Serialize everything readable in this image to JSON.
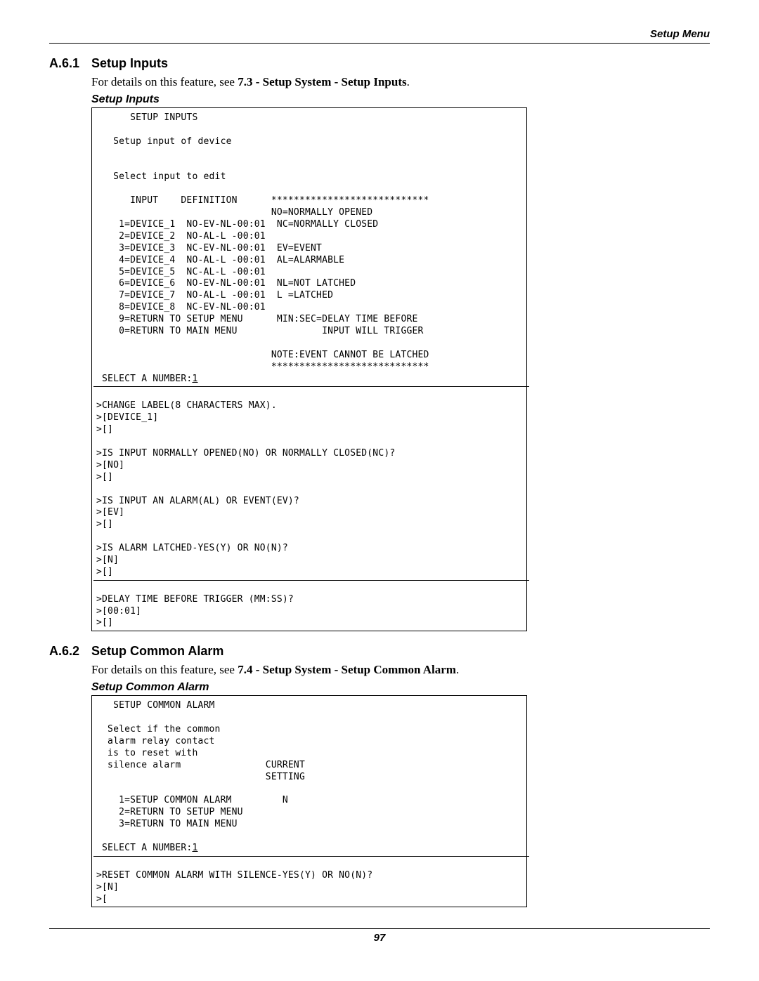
{
  "header": {
    "right": "Setup Menu"
  },
  "section1": {
    "num": "A.6.1",
    "title": "Setup Inputs",
    "intro_pre": "For details on this feature, see ",
    "intro_bold": "7.3 - Setup System - Setup Inputs",
    "intro_post": ".",
    "box_title": "Setup Inputs"
  },
  "terminal1": {
    "l01": "      SETUP INPUTS",
    "l02": "",
    "l03": "   Setup input of device",
    "l04": "",
    "l05": "",
    "l06": "   Select input to edit",
    "l07": "",
    "l08": "      INPUT    DEFINITION      ****************************",
    "l09": "                               NO=NORMALLY OPENED",
    "l10": "    1=DEVICE_1  NO-EV-NL-00:01  NC=NORMALLY CLOSED",
    "l11": "    2=DEVICE_2  NO-AL-L -00:01",
    "l12": "    3=DEVICE_3  NC-EV-NL-00:01  EV=EVENT",
    "l13": "    4=DEVICE_4  NO-AL-L -00:01  AL=ALARMABLE",
    "l14": "    5=DEVICE_5  NC-AL-L -00:01",
    "l15": "    6=DEVICE_6  NO-EV-NL-00:01  NL=NOT LATCHED",
    "l16": "    7=DEVICE_7  NO-AL-L -00:01  L =LATCHED",
    "l17": "    8=DEVICE_8  NC-EV-NL-00:01",
    "l18": "    9=RETURN TO SETUP MENU      MIN:SEC=DELAY TIME BEFORE",
    "l19": "    0=RETURN TO MAIN MENU               INPUT WILL TRIGGER",
    "l20": "",
    "l21": "                               NOTE:EVENT CANNOT BE LATCHED",
    "l22": "                               ****************************",
    "l23a": " SELECT A NUMBER:",
    "l23b": "1",
    "l24": "",
    "l25": ">CHANGE LABEL(8 CHARACTERS MAX).",
    "l26": ">[DEVICE_1]",
    "l27": ">[]",
    "l28": "",
    "l29": ">IS INPUT NORMALLY OPENED(NO) OR NORMALLY CLOSED(NC)?",
    "l30": ">[NO]",
    "l31": ">[]",
    "l32": "",
    "l33": ">IS INPUT AN ALARM(AL) OR EVENT(EV)?",
    "l34": ">[EV]",
    "l35": ">[]",
    "l36": "",
    "l37": ">IS ALARM LATCHED-YES(Y) OR NO(N)?",
    "l38": ">[N]",
    "l39": ">[]",
    "l40": "",
    "l41": ">DELAY TIME BEFORE TRIGGER (MM:SS)?",
    "l42": ">[00:01]",
    "l43": ">[]"
  },
  "section2": {
    "num": "A.6.2",
    "title": "Setup Common Alarm",
    "intro_pre": "For details on this feature, see ",
    "intro_bold": "7.4 - Setup System - Setup Common Alarm",
    "intro_post": ".",
    "box_title": "Setup Common Alarm"
  },
  "terminal2": {
    "l01": "   SETUP COMMON ALARM",
    "l02": "",
    "l03": "  Select if the common",
    "l04": "  alarm relay contact",
    "l05": "  is to reset with",
    "l06": "  silence alarm               CURRENT",
    "l07": "                              SETTING",
    "l08": "",
    "l09": "    1=SETUP COMMON ALARM         N",
    "l10": "    2=RETURN TO SETUP MENU",
    "l11": "    3=RETURN TO MAIN MENU",
    "l12": "",
    "l13a": " SELECT A NUMBER:",
    "l13b": "1",
    "l14": "",
    "l15": ">RESET COMMON ALARM WITH SILENCE-YES(Y) OR NO(N)?",
    "l16": ">[N]",
    "l17": ">["
  },
  "footer": {
    "page": "97"
  }
}
